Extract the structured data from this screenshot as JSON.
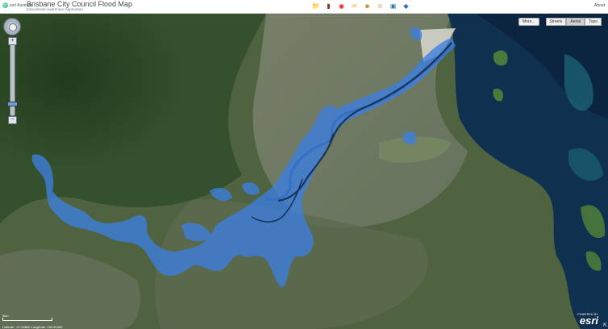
{
  "header": {
    "brand": "esri Australia",
    "title": "Brisbane City Council Flood Map",
    "subtitle": "Educational Awareness Application",
    "about_label": "About",
    "tools": [
      {
        "name": "folder-icon",
        "glyph": "📁",
        "color": "#e0a21c"
      },
      {
        "name": "book-icon",
        "glyph": "▮",
        "color": "#8b3a2a"
      },
      {
        "name": "record-icon",
        "glyph": "◉",
        "color": "#d22"
      },
      {
        "name": "note-icon",
        "glyph": "✉",
        "color": "#e8b84a"
      },
      {
        "name": "people-icon",
        "glyph": "☻",
        "color": "#c98b3a"
      },
      {
        "name": "user-icon",
        "glyph": "☺",
        "color": "#b0702a"
      },
      {
        "name": "print-icon",
        "glyph": "▣",
        "color": "#3a6fb0"
      },
      {
        "name": "cube-icon",
        "glyph": "◆",
        "color": "#2f64c8"
      }
    ]
  },
  "basemap": {
    "more_label": "More...",
    "options": [
      "Streets",
      "Aerial",
      "Topo"
    ],
    "selected": "Aerial"
  },
  "scale": {
    "label": "5km",
    "coords": "Latitude: -27.54800 Longitude: 152.91300"
  },
  "attribution": {
    "powered_by": "POWERED BY",
    "logo": "esri"
  },
  "colors": {
    "flood": "#3d7fe0",
    "river": "#1b3a6a",
    "bay": "#0f2c4d",
    "land": "#4a5f38"
  }
}
